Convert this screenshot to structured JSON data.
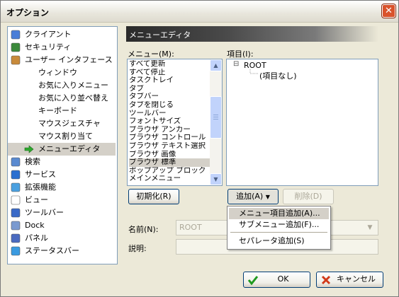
{
  "window": {
    "title": "オプション",
    "close_symbol": "✕"
  },
  "nav": {
    "items": [
      {
        "label": "クライアント",
        "icon": "client-icon"
      },
      {
        "label": "セキュリティ",
        "icon": "security-shield-icon"
      },
      {
        "label": "ユーザー インタフェース",
        "icon": "users-icon"
      },
      {
        "label": "ウィンドウ",
        "icon": ""
      },
      {
        "label": "お気に入りメニュー",
        "icon": ""
      },
      {
        "label": "お気に入り並べ替え",
        "icon": ""
      },
      {
        "label": "キーボード",
        "icon": ""
      },
      {
        "label": "マウスジェスチャ",
        "icon": ""
      },
      {
        "label": "マウス割り当て",
        "icon": ""
      },
      {
        "label": "メニューエディタ",
        "icon": "green-arrow-icon",
        "selected": true
      },
      {
        "label": "検索",
        "icon": "search-icon"
      },
      {
        "label": "サービス",
        "icon": "service-globe-icon"
      },
      {
        "label": "拡張機能",
        "icon": "extension-cube-icon"
      },
      {
        "label": "ビュー",
        "icon": "view-page-icon"
      },
      {
        "label": "ツールバー",
        "icon": "toolbar-icon"
      },
      {
        "label": "Dock",
        "icon": "dock-icon"
      },
      {
        "label": "パネル",
        "icon": "panel-icon"
      },
      {
        "label": "ステータスバー",
        "icon": "statusbar-icon"
      }
    ]
  },
  "editor": {
    "header": "メニューエディタ",
    "menu_label": "メニュー(M):",
    "items_label": "項目(I):",
    "menu_list": [
      "すべて更新",
      "すべて停止",
      "タスクトレイ",
      "タブ",
      "タブバー",
      "タブを閉じる",
      "ツールバー",
      "フォントサイズ",
      "ブラウザ アンカー",
      "ブラウザ コントロール",
      "ブラウザ テキスト選択",
      "ブラウザ 画像",
      "ブラウザ 標準",
      "ポップアップ ブロック",
      "メインメニュー"
    ],
    "selected_menu": "ブラウザ 標準",
    "tree_root": "ROOT",
    "tree_empty": "(項目なし)",
    "tree_toggle": "⊟",
    "init_button": "初期化(R)",
    "add_button": "追加(A)",
    "delete_button": "削除(D)",
    "name_label": "名前(N):",
    "name_value": "ROOT",
    "desc_label": "説明:",
    "desc_value": ""
  },
  "add_dropdown": {
    "items": [
      "メニュー項目追加(A)...",
      "サブメニュー追加(F)...",
      "セパレータ追加(S)"
    ],
    "highlighted_index": 0
  },
  "footer": {
    "ok_label": "OK",
    "cancel_label": "キャンセル"
  },
  "scroll_arrows": {
    "up": "▲",
    "down": "▼",
    "dropdown": "▼"
  }
}
